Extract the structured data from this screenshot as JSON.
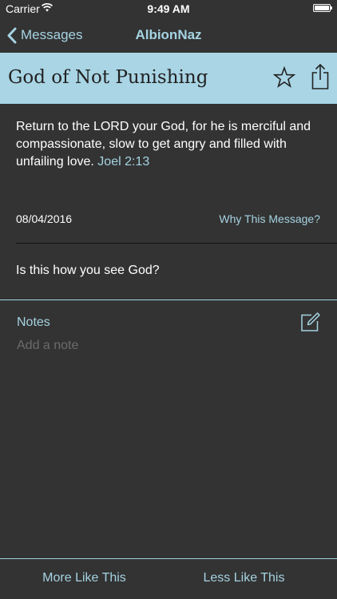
{
  "status_bar": {
    "carrier": "Carrier",
    "time": "9:49 AM",
    "wifi_icon": "wifi-icon",
    "battery_icon": "battery-icon"
  },
  "nav": {
    "back_label": "Messages",
    "title": "AlbionNaz"
  },
  "message": {
    "title": "God of Not Punishing",
    "body": "Return to the LORD your God, for he is merciful and compassionate, slow to get angry and filled with unfailing love. ",
    "reference": "Joel 2:13",
    "date": "08/04/2016",
    "why_link": "Why This Message?",
    "question": "Is this how you see God?"
  },
  "notes": {
    "label": "Notes",
    "value": "",
    "placeholder": "Add a note"
  },
  "toolbar": {
    "more_label": "More Like This",
    "less_label": "Less Like This"
  },
  "colors": {
    "background": "#333333",
    "accent": "#a5d3e2",
    "banner": "#a9d5e5"
  }
}
